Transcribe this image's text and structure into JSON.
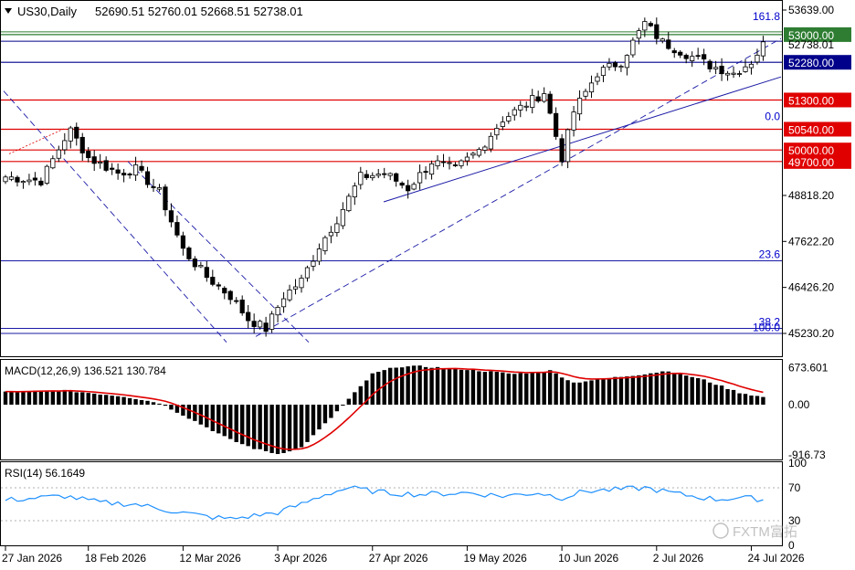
{
  "header": {
    "symbol": "US30,Daily",
    "ohlc": "52690.51 52760.01 52668.51 52738.01"
  },
  "watermark": "FXTM富拓",
  "colors": {
    "bull": "#ffffff",
    "bear": "#000000",
    "outline": "#000000",
    "support_line": "#00008b",
    "resistance_line": "#e00000",
    "top_line": "#2e7d32",
    "fib_line": "#1a1aa6",
    "trend_line": "#1a1aa6",
    "macd_hist": "#000000",
    "macd_signal": "#e00000",
    "rsi_line": "#1e90ff",
    "label_red": "#e00000",
    "label_blue": "#0000cc",
    "label_green": "#2e7d32"
  },
  "chart_data": [
    {
      "type": "candlestick",
      "y_range": [
        44800,
        53900
      ],
      "price_ticks": [
        "53639.00",
        "48818.20",
        "47622.20",
        "46426.20",
        "45230.20"
      ],
      "level_labels": [
        {
          "text": "53000.00",
          "value": 53000,
          "color": "green"
        },
        {
          "text": "52738.01",
          "value": 52738,
          "color": "black"
        },
        {
          "text": "52280.00",
          "value": 52280,
          "color": "blue"
        },
        {
          "text": "51300.00",
          "value": 51300,
          "color": "red"
        },
        {
          "text": "50540.00",
          "value": 50540,
          "color": "red"
        },
        {
          "text": "50000.00",
          "value": 50000,
          "color": "red"
        },
        {
          "text": "49700.00",
          "value": 49700,
          "color": "red"
        }
      ],
      "fib_labels": [
        {
          "text": "161.8",
          "value": 53310
        },
        {
          "text": "0.0",
          "value": 50710
        },
        {
          "text": "23.6",
          "value": 47120
        },
        {
          "text": "38.2",
          "value": 45360
        },
        {
          "text": "100.0",
          "value": 45220
        }
      ],
      "x_labels": [
        "27 Jan 2026",
        "18 Feb 2026",
        "12 Mar 2026",
        "3 Apr 2026",
        "27 Apr 2026",
        "19 May 2026",
        "10 Jun 2026",
        "2 Jul 2026",
        "24 Jul 2026"
      ],
      "candle_count": 129
    },
    {
      "type": "bar",
      "title": "MACD(12,26,9) 136.521 130.784",
      "y_range": [
        -1000,
        800
      ],
      "ticks": [
        "673.601",
        "0.00",
        "-916.73"
      ],
      "bar_count": 129
    },
    {
      "type": "line",
      "title": "RSI(14) 56.1649",
      "y_range": [
        0,
        100
      ],
      "ticks": [
        "100",
        "70",
        "30",
        "0"
      ],
      "levels": [
        70,
        30
      ]
    }
  ]
}
